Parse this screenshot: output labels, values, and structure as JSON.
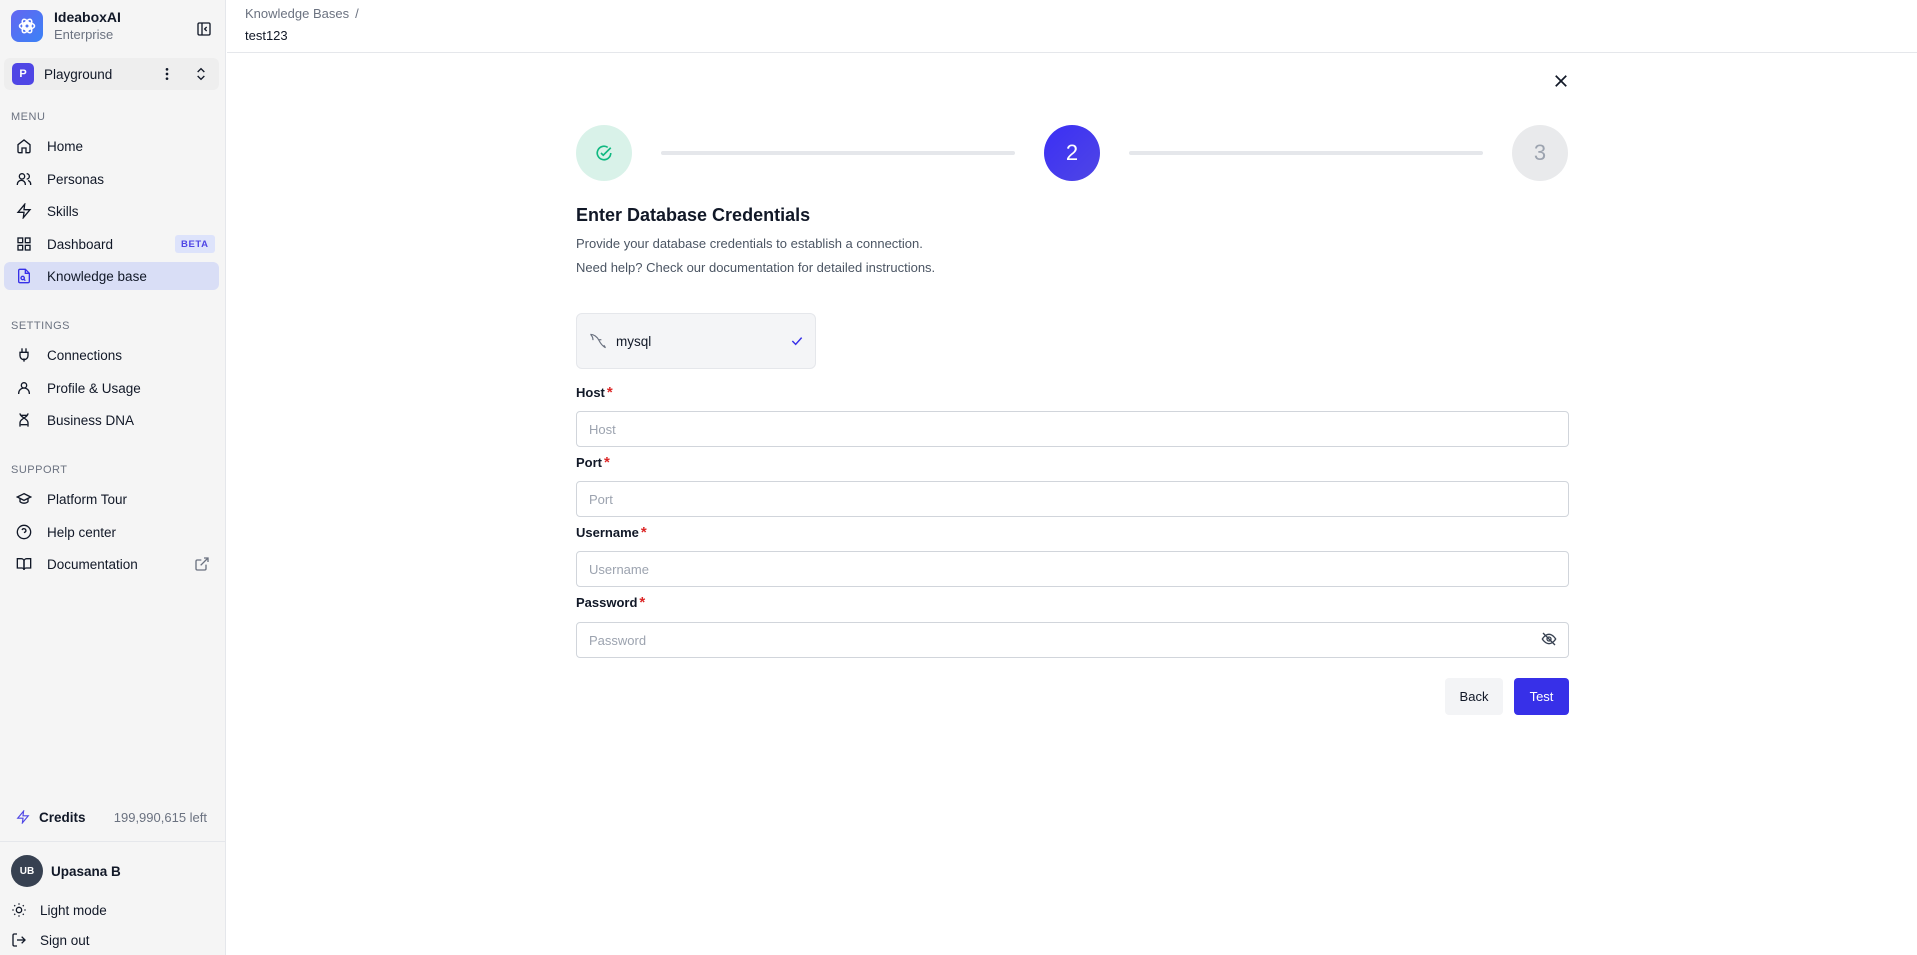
{
  "brand": {
    "name": "IdeaboxAI",
    "plan": "Enterprise"
  },
  "workspace": {
    "initial": "P",
    "name": "Playground"
  },
  "menu": {
    "label": "MENU",
    "items": [
      {
        "label": "Home",
        "icon": "home-icon"
      },
      {
        "label": "Personas",
        "icon": "users-icon"
      },
      {
        "label": "Skills",
        "icon": "zap-icon"
      },
      {
        "label": "Dashboard",
        "icon": "grid-icon",
        "badge": "BETA"
      },
      {
        "label": "Knowledge base",
        "icon": "file-search-icon",
        "active": true
      }
    ]
  },
  "settings": {
    "label": "SETTINGS",
    "items": [
      {
        "label": "Connections",
        "icon": "plug-icon"
      },
      {
        "label": "Profile & Usage",
        "icon": "user-icon"
      },
      {
        "label": "Business DNA",
        "icon": "dna-icon"
      }
    ]
  },
  "support": {
    "label": "SUPPORT",
    "items": [
      {
        "label": "Platform Tour",
        "icon": "graduation-cap-icon"
      },
      {
        "label": "Help center",
        "icon": "help-circle-icon"
      },
      {
        "label": "Documentation",
        "icon": "book-icon"
      }
    ]
  },
  "credits": {
    "label": "Credits",
    "value": "199,990,615 left"
  },
  "user": {
    "initials": "UB",
    "name": "Upasana B"
  },
  "footer": {
    "theme_label": "Light mode",
    "signout_label": "Sign out"
  },
  "breadcrumb": {
    "parent": "Knowledge Bases",
    "separator": "/",
    "current": "test123"
  },
  "stepper": {
    "step2": "2",
    "step3": "3"
  },
  "form": {
    "title": "Enter Database Credentials",
    "desc1": "Provide your database credentials to establish a connection.",
    "desc2": "Need help? Check our documentation for detailed instructions.",
    "db_type": "mysql",
    "fields": {
      "host": {
        "label": "Host",
        "placeholder": "Host",
        "value": ""
      },
      "port": {
        "label": "Port",
        "placeholder": "Port",
        "value": ""
      },
      "username": {
        "label": "Username",
        "placeholder": "Username",
        "value": ""
      },
      "password": {
        "label": "Password",
        "placeholder": "Password",
        "value": ""
      }
    },
    "required_mark": "*",
    "back_label": "Back",
    "test_label": "Test"
  },
  "colors": {
    "accent": "#3730e8",
    "active_nav": "#d9def6",
    "required": "#dc2626",
    "success_bg": "#d9f2e9"
  }
}
